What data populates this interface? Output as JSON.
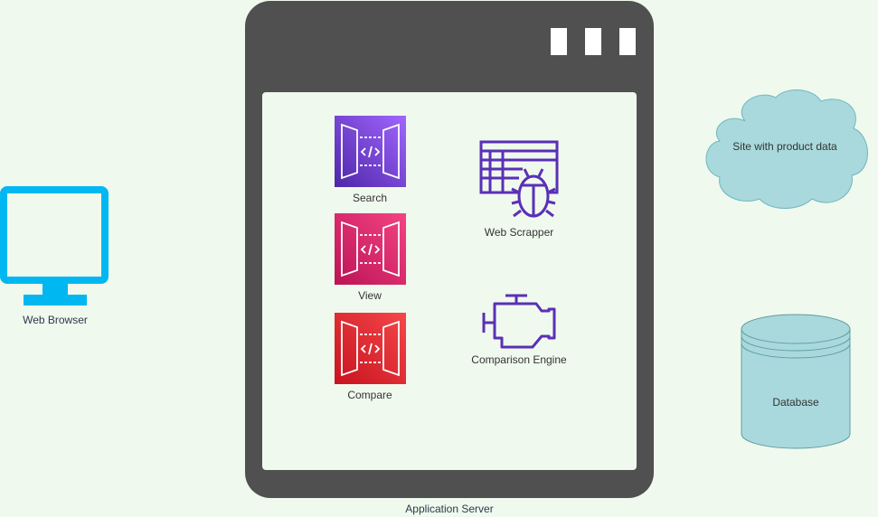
{
  "nodes": {
    "web_browser": {
      "label": "Web Browser",
      "icon": "monitor-icon",
      "color": "#00b7f1"
    },
    "application_server": {
      "label": "Application Server",
      "icon": "browser-window-icon",
      "frame_color": "#505050",
      "window_bg": "#f0f9ee",
      "window_buttons": 3
    },
    "search": {
      "label": "Search",
      "icon": "api-gateway-icon",
      "gradient": [
        "#a166ff",
        "#4d27a8"
      ]
    },
    "view": {
      "label": "View",
      "icon": "api-gateway-icon",
      "gradient": [
        "#f34482",
        "#bc1356"
      ]
    },
    "compare": {
      "label": "Compare",
      "icon": "api-gateway-icon",
      "gradient": [
        "#f54749",
        "#c7131f"
      ]
    },
    "web_scrapper": {
      "label": "Web Scrapper",
      "icon": "table-with-bug-icon",
      "color": "#5a30b5"
    },
    "comparison_engine": {
      "label": "Comparison Engine",
      "icon": "engine-icon",
      "color": "#5a30b5"
    },
    "product_site": {
      "label": "Site with product data",
      "icon": "cloud-icon",
      "fill": "#a9d9dc"
    },
    "database": {
      "label": "Database",
      "icon": "cylinder-icon",
      "fill": "#a9d9dc"
    }
  }
}
